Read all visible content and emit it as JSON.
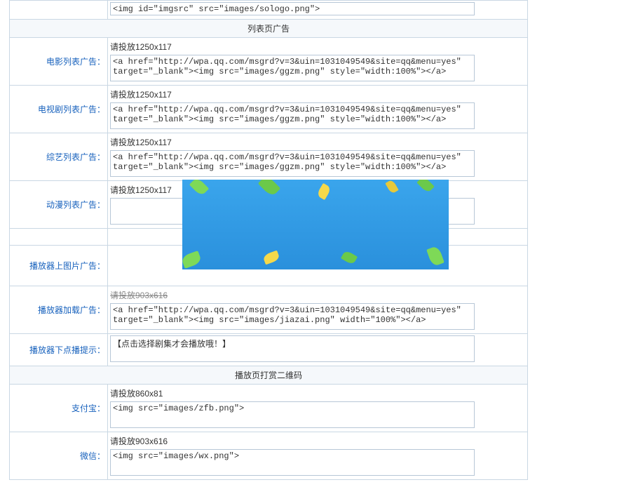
{
  "topTextarea": {
    "value": "<img id=\"imgsrc\" src=\"images/sologo.png\">"
  },
  "section1": {
    "title": "列表页广告"
  },
  "rows": [
    {
      "label": "电影列表广告：",
      "hint": "请投放1250x117",
      "value": "<a href=\"http://wpa.qq.com/msgrd?v=3&uin=1031049549&site=qq&menu=yes\" target=\"_blank\"><img src=\"images/ggzm.png\" style=\"width:100%\"></a>"
    },
    {
      "label": "电视剧列表广告：",
      "hint": "请投放1250x117",
      "value": "<a href=\"http://wpa.qq.com/msgrd?v=3&uin=1031049549&site=qq&menu=yes\" target=\"_blank\"><img src=\"images/ggzm.png\" style=\"width:100%\"></a>"
    },
    {
      "label": "综艺列表广告：",
      "hint": "请投放1250x117",
      "value": "<a href=\"http://wpa.qq.com/msgrd?v=3&uin=1031049549&site=qq&menu=yes\" target=\"_blank\"><img src=\"images/ggzm.png\" style=\"width:100%\"></a>"
    },
    {
      "label": "动漫列表广告：",
      "hint": "请投放1250x117",
      "value": ""
    }
  ],
  "playerRows": [
    {
      "label": "播放器上图片广告：",
      "hint": "",
      "value": ""
    },
    {
      "label": "播放器加载广告：",
      "hint": "请投放903x616",
      "value": "<a href=\"http://wpa.qq.com/msgrd?v=3&uin=1031049549&site=qq&menu=yes\" target=\"_blank\"><img src=\"images/jiazai.png\" width=\"100%\"></a>",
      "hintHidden": true
    },
    {
      "label": "播放器下点播提示：",
      "hint": "",
      "value": "【点击选择剧集才会播放哦！】"
    }
  ],
  "section2": {
    "title": "播放页打赏二维码"
  },
  "qrRows": [
    {
      "label": "支付宝：",
      "hint": "请投放860x81",
      "value": "<img src=\"images/zfb.png\">"
    },
    {
      "label": "微信：",
      "hint": "请投放903x616",
      "value": "<img src=\"images/wx.png\">"
    }
  ]
}
